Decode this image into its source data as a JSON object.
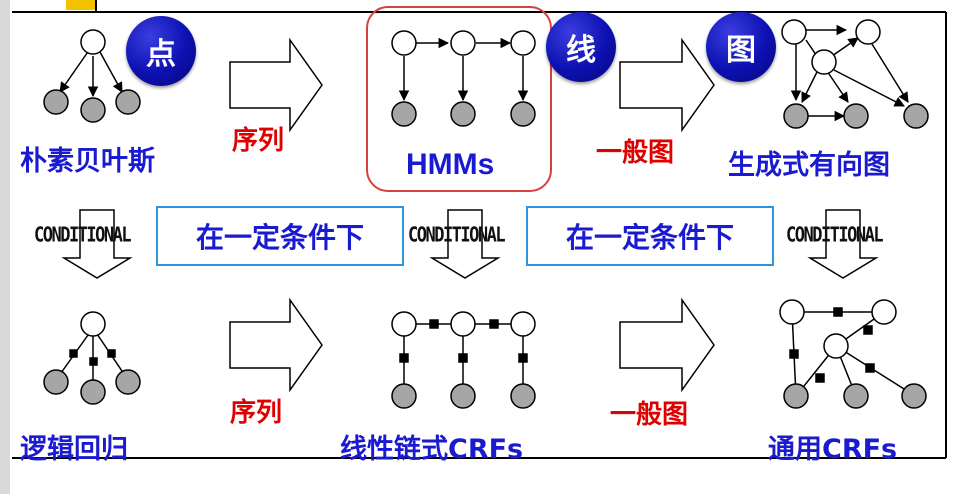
{
  "badges": {
    "point": "点",
    "line": "线",
    "graph": "图"
  },
  "top_row": {
    "naive_bayes": "朴素贝叶斯",
    "hmms": "HMMs",
    "generative_directed": "生成式有向图",
    "sequence": "序列",
    "general_graph": "一般图"
  },
  "bottom_row": {
    "logistic_regression": "逻辑回归",
    "linear_chain_crfs": "线性链式CRFs",
    "general_crfs": "通用CRFs",
    "sequence": "序列",
    "general_graph": "一般图"
  },
  "conditional": "CONDITIONAL",
  "condition_box": "在一定条件下",
  "colors": {
    "badge_blue": "#0d10b0",
    "label_blue": "#1a1ad0",
    "label_red": "#e00000",
    "box_border": "#2e96e0",
    "hmm_border": "#d84040",
    "node_gray": "#a6a6a6",
    "corner_yellow": "#f2c200"
  }
}
